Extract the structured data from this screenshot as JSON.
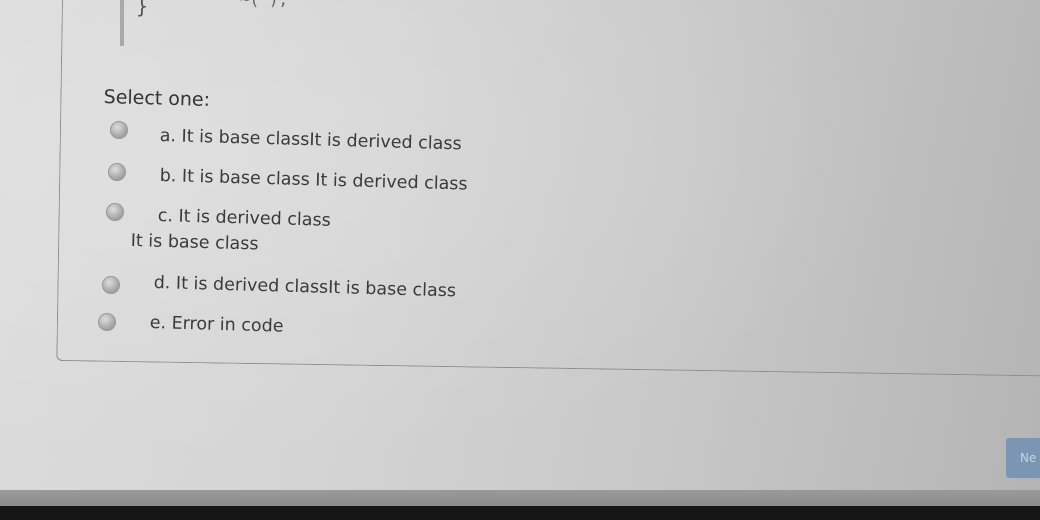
{
  "code": {
    "closing_brace": "}",
    "fragment": "~( );"
  },
  "question": {
    "prompt": "Select one:",
    "options": [
      {
        "label": "a. It is base classIt is derived class",
        "subline": ""
      },
      {
        "label": "b.  It is base class It is derived class",
        "subline": ""
      },
      {
        "label": "c. It is derived class",
        "subline": "It is base class"
      },
      {
        "label": "d. It is derived classIt is base class",
        "subline": ""
      },
      {
        "label": "e. Error in code",
        "subline": ""
      }
    ]
  },
  "navigation": {
    "next_label": "Ne"
  },
  "colors": {
    "background": "#d4d4d4",
    "text": "#3a3a3a",
    "next_button": "#7a96b3",
    "bezel": "#151515"
  }
}
